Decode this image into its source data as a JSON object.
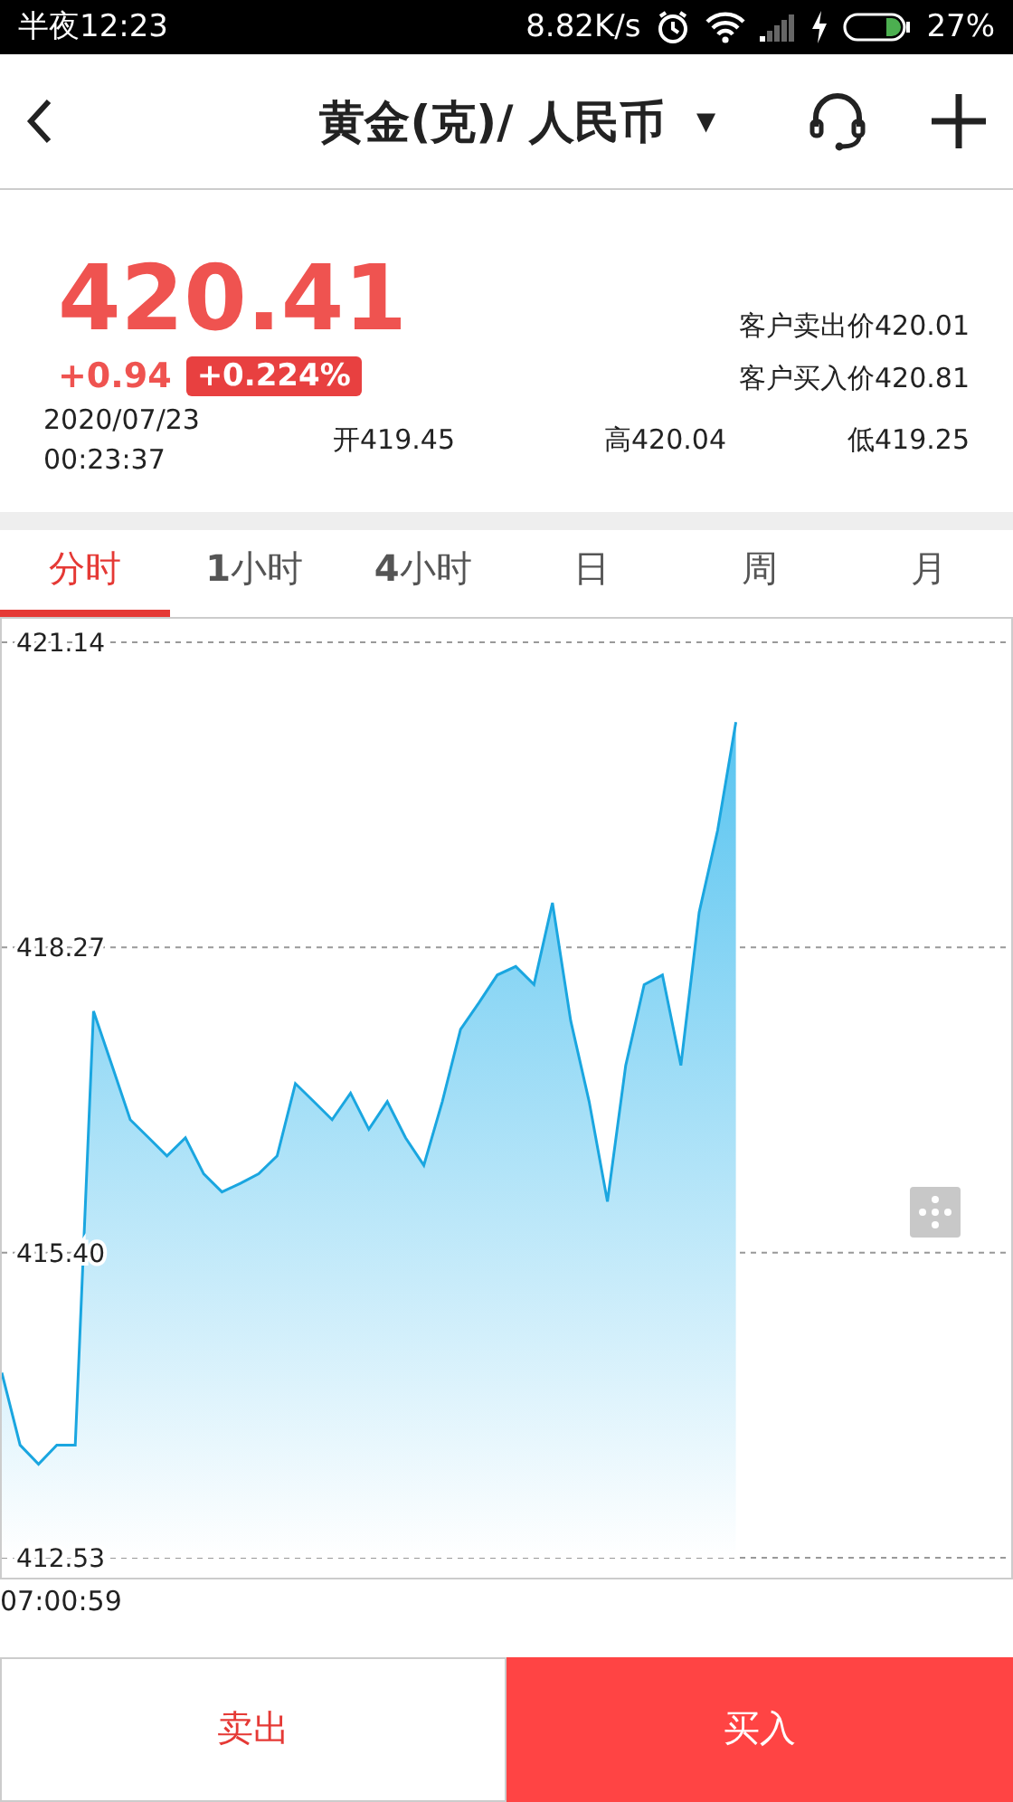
{
  "status_bar": {
    "time": "半夜12:23",
    "net_speed": "8.82K/s",
    "battery": "27%"
  },
  "header": {
    "title": "黄金(克)/ 人民币",
    "dropdown": "▼"
  },
  "quote": {
    "price": "420.41",
    "change": "+0.94",
    "change_pct": "+0.224%",
    "sell_price": "客户卖出价420.01",
    "buy_price": "客户买入价420.81",
    "date": "2020/07/23",
    "time": "00:23:37",
    "open": "开419.45",
    "high": "高420.04",
    "low": "低419.25"
  },
  "tabs": [
    {
      "label": "分时",
      "selected": true
    },
    {
      "label": "**1**小时",
      "selected": false
    },
    {
      "label": "**4**小时",
      "selected": false
    },
    {
      "label": "日",
      "selected": false
    },
    {
      "label": "周",
      "selected": false
    },
    {
      "label": "月",
      "selected": false
    }
  ],
  "chart": {
    "chart_data": {
      "type": "area",
      "categories": [
        null,
        null,
        null,
        null,
        null,
        null,
        null,
        null,
        null,
        null,
        null,
        null,
        null,
        null,
        null,
        null,
        null,
        null,
        null,
        null,
        null,
        null,
        null,
        null,
        null,
        null,
        null,
        null,
        null,
        null,
        null,
        null,
        null,
        null,
        null,
        null,
        null,
        null,
        null,
        null,
        null,
        null,
        null,
        null,
        null,
        null,
        null,
        null,
        null,
        null,
        null,
        null,
        null,
        null,
        null,
        null
      ],
      "series": [
        {
          "color": "#1aa6e0",
          "values": [
            414.27,
            413.59,
            413.41,
            413.59,
            413.59,
            417.67,
            417.16,
            416.65,
            416.48,
            416.31,
            416.48,
            416.14,
            415.97,
            416.05,
            416.14,
            416.31,
            416.99,
            416.82,
            416.65,
            416.9,
            416.56,
            416.82,
            416.48,
            416.22,
            416.82,
            417.5,
            417.75,
            418.01,
            418.09,
            417.92,
            418.69,
            417.58,
            416.82,
            415.88,
            417.16,
            417.92,
            418.01,
            417.16,
            418.6,
            419.37,
            420.39,
            null,
            null,
            null,
            null,
            null,
            null,
            null,
            null,
            null,
            null,
            null,
            null,
            null,
            null,
            null
          ]
        }
      ],
      "ylim": [
        412.53,
        421.14
      ],
      "yticks": [
        {
          "value": 421.14,
          "label": "421.14"
        },
        {
          "value": 418.27,
          "label": "418.27"
        },
        {
          "value": 415.4,
          "label": "415.40"
        },
        {
          "value": 412.53,
          "label": "412.53"
        }
      ]
    },
    "start_time": "07:00:59"
  },
  "buttons": [
    {
      "label": "卖出",
      "kind": "sell"
    },
    {
      "label": "买入",
      "kind": "buy"
    }
  ]
}
